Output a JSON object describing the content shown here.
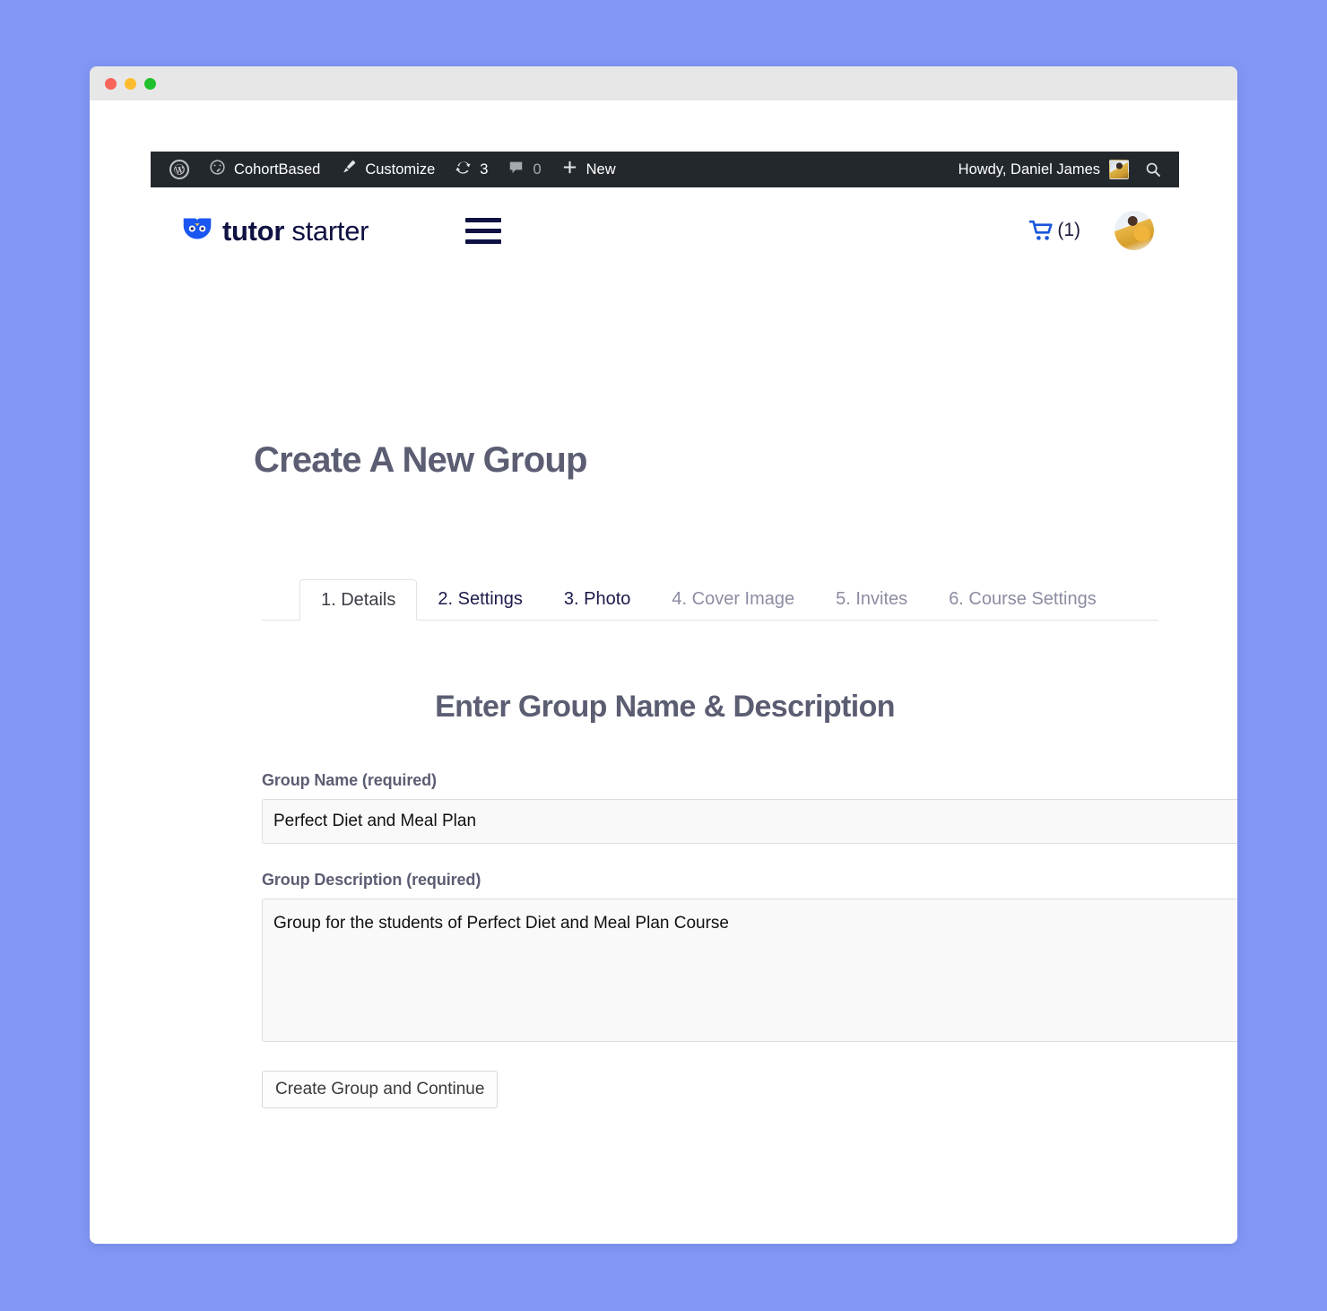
{
  "window": {
    "traffic_lights": [
      "close",
      "minimize",
      "zoom"
    ],
    "colors": {
      "close": "#f9655b",
      "minimize": "#fdbc2d",
      "zoom": "#21c12e",
      "desktop": "#8296f5"
    }
  },
  "admin_bar": {
    "wp_logo_label": "W",
    "site_name": "CohortBased",
    "customize_label": "Customize",
    "updates_count": "3",
    "comments_count": "0",
    "new_label": "New",
    "howdy": "Howdy, Daniel James",
    "icons": {
      "wordpress": "wordpress-icon",
      "dashboard": "dashboard-icon",
      "customize": "paintbrush-icon",
      "updates": "updates-refresh-icon",
      "comments": "comment-bubble-icon",
      "new": "plus-icon",
      "search": "search-icon",
      "avatar": "admin-avatar"
    }
  },
  "site_header": {
    "brand_bold": "tutor",
    "brand_light": "starter",
    "menu_icon": "hamburger-menu-icon",
    "cart_icon": "shopping-cart-icon",
    "cart_count": "(1)",
    "avatar": "user-avatar"
  },
  "page": {
    "title": "Create A New Group",
    "section_heading": "Enter Group Name & Description"
  },
  "tabs": [
    {
      "label": "1. Details",
      "state": "active"
    },
    {
      "label": "2. Settings",
      "state": "enabled"
    },
    {
      "label": "3. Photo",
      "state": "enabled"
    },
    {
      "label": "4. Cover Image",
      "state": "muted"
    },
    {
      "label": "5. Invites",
      "state": "muted"
    },
    {
      "label": "6. Course Settings",
      "state": "muted"
    }
  ],
  "form": {
    "group_name_label": "Group Name (required)",
    "group_name_value": "Perfect Diet and Meal Plan",
    "group_name_placeholder": "",
    "group_description_label": "Group Description (required)",
    "group_description_value": "Group for the students of Perfect Diet and Meal Plan Course",
    "group_description_placeholder": "",
    "submit_label": "Create Group and Continue"
  },
  "colors": {
    "admin_bar_bg": "#23282d",
    "brand_navy": "#0f1142",
    "heading_slate": "#5b5d72",
    "tab_active_text": "#3c3c46",
    "tab_muted_text": "#8c8da2",
    "cart_blue": "#1a56db",
    "input_bg": "#f9f9f9"
  }
}
